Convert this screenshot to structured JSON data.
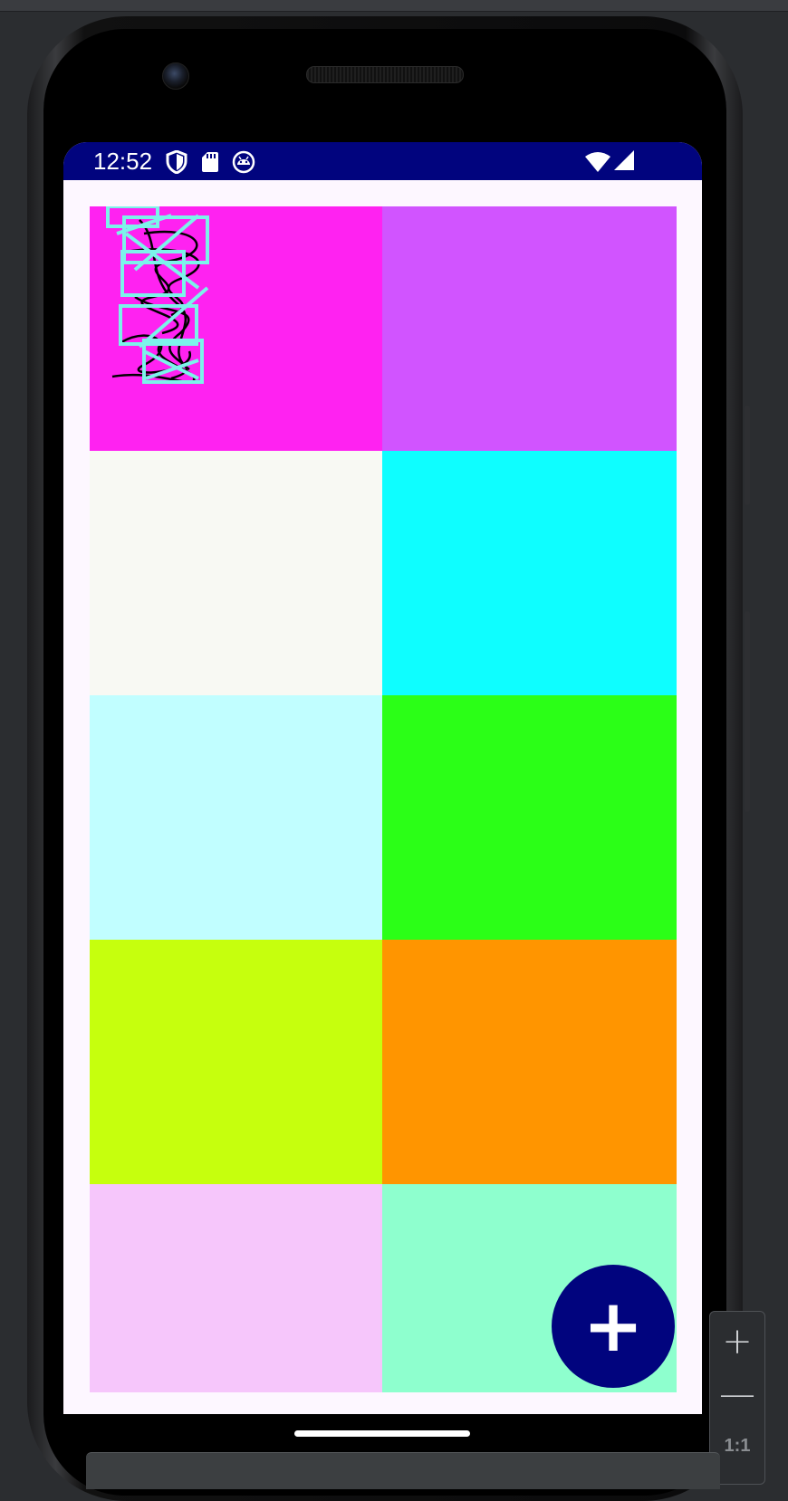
{
  "status_bar": {
    "time": "12:52",
    "left_icons": [
      "shield-icon",
      "sd-card-icon",
      "android-debug-icon"
    ],
    "right_icons": [
      "wifi-icon",
      "cellular-signal-icon"
    ]
  },
  "tiles": [
    {
      "name": "tile-magenta",
      "color": "#ff22f1",
      "has_drawing": true
    },
    {
      "name": "tile-purple",
      "color": "#d154ff"
    },
    {
      "name": "tile-off-white",
      "color": "#f8f9f3"
    },
    {
      "name": "tile-cyan",
      "color": "#0efeff"
    },
    {
      "name": "tile-light-cyan",
      "color": "#c1feff"
    },
    {
      "name": "tile-green",
      "color": "#2bff17"
    },
    {
      "name": "tile-lime",
      "color": "#c6ff0d"
    },
    {
      "name": "tile-orange",
      "color": "#ff9500"
    },
    {
      "name": "tile-pink",
      "color": "#f6c6fb"
    },
    {
      "name": "tile-mint",
      "color": "#8effce"
    }
  ],
  "fab": {
    "label": "+",
    "icon": "plus-icon",
    "color": "#01047e"
  },
  "emulator_controls": {
    "zoom_in": "+",
    "zoom_out": "—",
    "zoom_reset": "1:1"
  },
  "colors": {
    "status_bar": "#01047e",
    "screen_background": "#fdf7ff",
    "sketch_stroke": "#000000",
    "sketch_box": "#7cf3ea"
  }
}
